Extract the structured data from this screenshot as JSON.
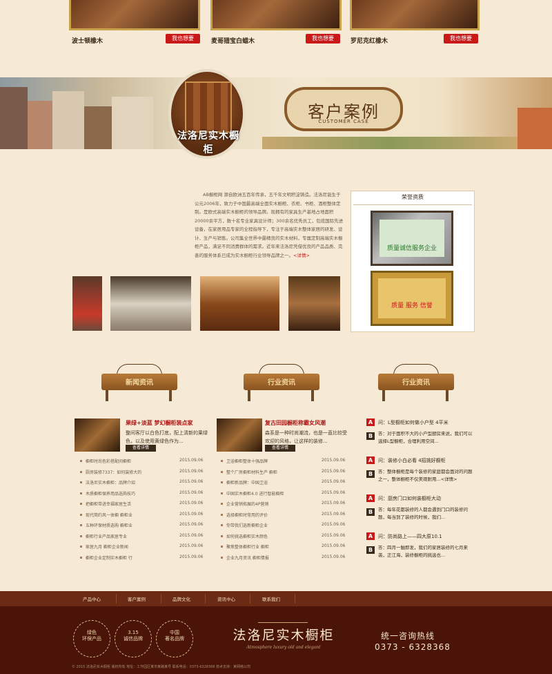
{
  "products": [
    {
      "name": "波士顿橡木",
      "button": "我也想要"
    },
    {
      "name": "麦哥猎宝白蜡木",
      "button": "我也想要"
    },
    {
      "name": "罗尼克红橡木",
      "button": "我也想要"
    }
  ],
  "banner": {
    "circle_title": "法洛尼实木橱柜",
    "section_title": "客户案例",
    "section_subtitle": "CUSTOMER CASE"
  },
  "intro": {
    "text": "AB橱柜网 源自欧洲五百年传承，五千年文明积淀铸造。法洛尼诞生于公元2006年，致力于中国最高端全面实木橱柜、衣柜、书柜、酒柜整体定制。是欧式高端实木橱柜的领导品牌。现拥有的家具生产基地占地面积20000余平方，数十名专业家具设计师；300余名优秀员工，包揽国际先进设备，在家居用品专家的全程指导下，专注于高端实木整体家居的研发、设计、生产与销售。公司集全世界中最精良的实木材料，专属定制高端实木橱柜产品，满足不同消费群体的需求。近年来法洛尼凭借优良的产品品质、完善的服务体系已成为实木橱柜行业领导品牌之一。",
    "more_label": "<详情>"
  },
  "honor": {
    "title": "荣誉资质",
    "cert1_text": "质量诚信服务企业",
    "cert2_text": "质量 服务 信誉"
  },
  "news_signs": [
    "新闻资讯",
    "行业资讯",
    "行业资讯"
  ],
  "news_columns": [
    {
      "feature_title": "果绿+淡蓝 梦幻橱柜装点家",
      "feature_desc": "整间客厅以白色打底，配上清新的果绿色，以及使用黄绿色作为...",
      "feature_button": "查看详情",
      "items": [
        {
          "title": "橱柜时尚色彩搭配间橱柜",
          "date": "2015.09.06"
        },
        {
          "title": "厨房装修7337：如何装修大的",
          "date": "2015.09.06"
        },
        {
          "title": "法洛尼实木橱柜：品牌介绍",
          "date": "2015.09.06"
        },
        {
          "title": "木质橱柜保养用品选购技巧",
          "date": "2015.09.06"
        },
        {
          "title": "把橱柜带进幸福家居生活",
          "date": "2015.09.06"
        },
        {
          "title": "现代简约风一体橱 橱柜业",
          "date": "2015.09.06"
        },
        {
          "title": "五种环保材质选购 橱柜业",
          "date": "2015.09.06"
        },
        {
          "title": "橱柜行业产品家居专业",
          "date": "2015.09.06"
        },
        {
          "title": "家居九月 橱柜企业新闻",
          "date": "2015.09.06"
        },
        {
          "title": "橱柜企业定制实木橱柜 行",
          "date": "2015.09.06"
        }
      ]
    },
    {
      "feature_title": "复古田园橱柜称霸女风潮",
      "feature_desc": "森系是一种时尚潮流，也是一直比较受欢迎的风格，让这样的装修...",
      "feature_button": "查看详情",
      "items": [
        {
          "title": "卫浴橱柜整体十强品牌",
          "date": "2015.09.06"
        },
        {
          "title": "整个厂房橱柜材料生产 橱柜",
          "date": "2015.09.06"
        },
        {
          "title": "橱柜新品牌：中国卫浴",
          "date": "2015.09.06"
        },
        {
          "title": "中国实木橱柜4.0 进行智能橱柜",
          "date": "2015.09.06"
        },
        {
          "title": "企业营销拓展的4P营销",
          "date": "2015.09.06"
        },
        {
          "title": "选择橱柜时常用的评价",
          "date": "2015.09.06"
        },
        {
          "title": "你带我们选新橱柜企业",
          "date": "2015.09.06"
        },
        {
          "title": "如何挑选橱柜实木颜色",
          "date": "2015.09.06"
        },
        {
          "title": "聚焦整体橱柜行业 橱柜",
          "date": "2015.09.06"
        },
        {
          "title": "企业九月资讯 橱柜情报",
          "date": "2015.09.06"
        }
      ]
    }
  ],
  "qa": [
    {
      "q": "问：L型橱柜如何做小户型 4平米",
      "a": "答：对于面积不大的小户型厨房来说，我们可以选择L型橱柜，合理利用空间..."
    },
    {
      "q": "问：装修小白必看 4招挑好橱柜",
      "a": "答：整体橱柜是每个装修的家庭都会面对的问题之一，整体橱柜不仅美观耐用...<详情>"
    },
    {
      "q": "问：厨房门口如何装橱柜大动",
      "a": "答：每年花都装修的人都会遇到门口的装修问题，每当到了装修的时候，我们..."
    },
    {
      "q": "问：防尚路上——四大原10.1",
      "a": "答：四月一触即发，我们的家居装修的七月来袭，正江海，装修橱柜的挑选也..."
    }
  ],
  "footer": {
    "nav": [
      "产品中心",
      "客户案例",
      "品牌文化",
      "资讯中心",
      "联系我们"
    ],
    "badges": [
      "绿色\n环保产品",
      "3.15\n诚信品牌",
      "中国\n著名品牌"
    ],
    "brand": "法洛尼实木橱柜",
    "slogan": "Atmosphere luxury old and elegant",
    "hotline_label": "统一咨询热线",
    "phone": "0373 - 6328368",
    "copyright": "© 2015 法洛尼实木橱柜 版权所有    地址：工作园区某市某路某号    联系电话：0373-6328368    技术支持：某网络公司"
  },
  "colors": {
    "accent": "#c81818",
    "footer_bg": "#4a1508",
    "nav_bg": "#6b2a14",
    "page_bg": "#f6ead6"
  }
}
